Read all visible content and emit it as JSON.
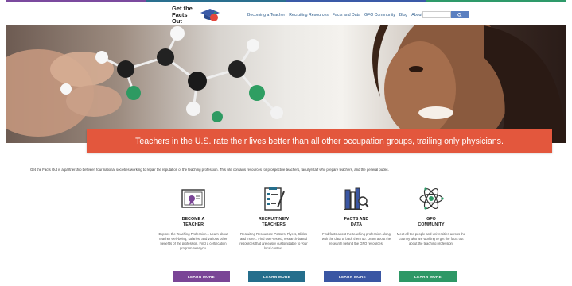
{
  "header": {
    "logo_line1": "Get the",
    "logo_line2": "Facts Out",
    "nav": [
      "Becoming a Teacher",
      "Recruiting Resources",
      "Facts and Data",
      "GFO Community",
      "Blog",
      "About"
    ],
    "search_placeholder": ""
  },
  "banner": {
    "text": "Teachers in the U.S. rate their lives better than all other occupation groups, trailing only physicians."
  },
  "intro": "Get the Facts Out is a partnership between four national societies working to repair the reputation of the teaching profession. This site contains resources for prospective teachers, faculty/staff who prepare teachers, and the general public.",
  "cards": [
    {
      "title_line1": "BECOME A",
      "title_line2": "TEACHER",
      "desc": "Explore the Teaching Profession... Learn about teacher well-being, salaries, and various other benefits of the profession. Find a certification program near you.",
      "button": "LEARN MORE",
      "color": "#7a4596",
      "icon": "certificate-icon"
    },
    {
      "title_line1": "RECRUIT NEW",
      "title_line2": "TEACHERS",
      "desc": "Recruiting Resources: Posters, Flyers, Slides and more... Find user-tested, research-based resources that are easily customizable to your local context.",
      "button": "LEARN MORE",
      "color": "#256e8c",
      "icon": "clipboard-pen-icon"
    },
    {
      "title_line1": "FACTS AND",
      "title_line2": "DATA",
      "desc": "Find facts about the teaching profession along with the data to back them up. Learn about the research behind the GFO resources.",
      "button": "LEARN MORE",
      "color": "#3a56a3",
      "icon": "books-magnifier-icon"
    },
    {
      "title_line1": "GFO",
      "title_line2": "COMMUNITY",
      "desc": "Meet all the people and universities across the country who are working to get the facts out about the teaching profession.",
      "button": "LEARN MORE",
      "color": "#2e9866",
      "icon": "atom-icon"
    }
  ]
}
